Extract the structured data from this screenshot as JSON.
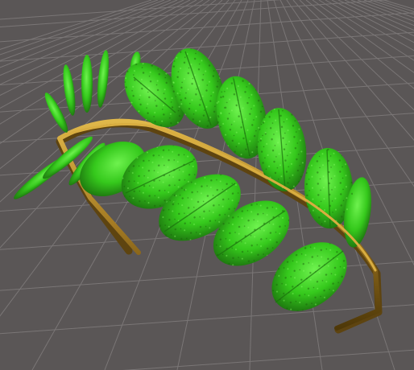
{
  "scene": {
    "background_color": "#5a5656",
    "grid_line_color": "#7a7676",
    "grid_visible": true,
    "subject": "leaf-tiara",
    "band_color": "#b48a2a",
    "band_shadow_color": "#5e4410",
    "leaf_color": "#35c91c",
    "leaf_highlight_color": "#5cf040",
    "leaf_dark_color": "#1f7a10"
  }
}
